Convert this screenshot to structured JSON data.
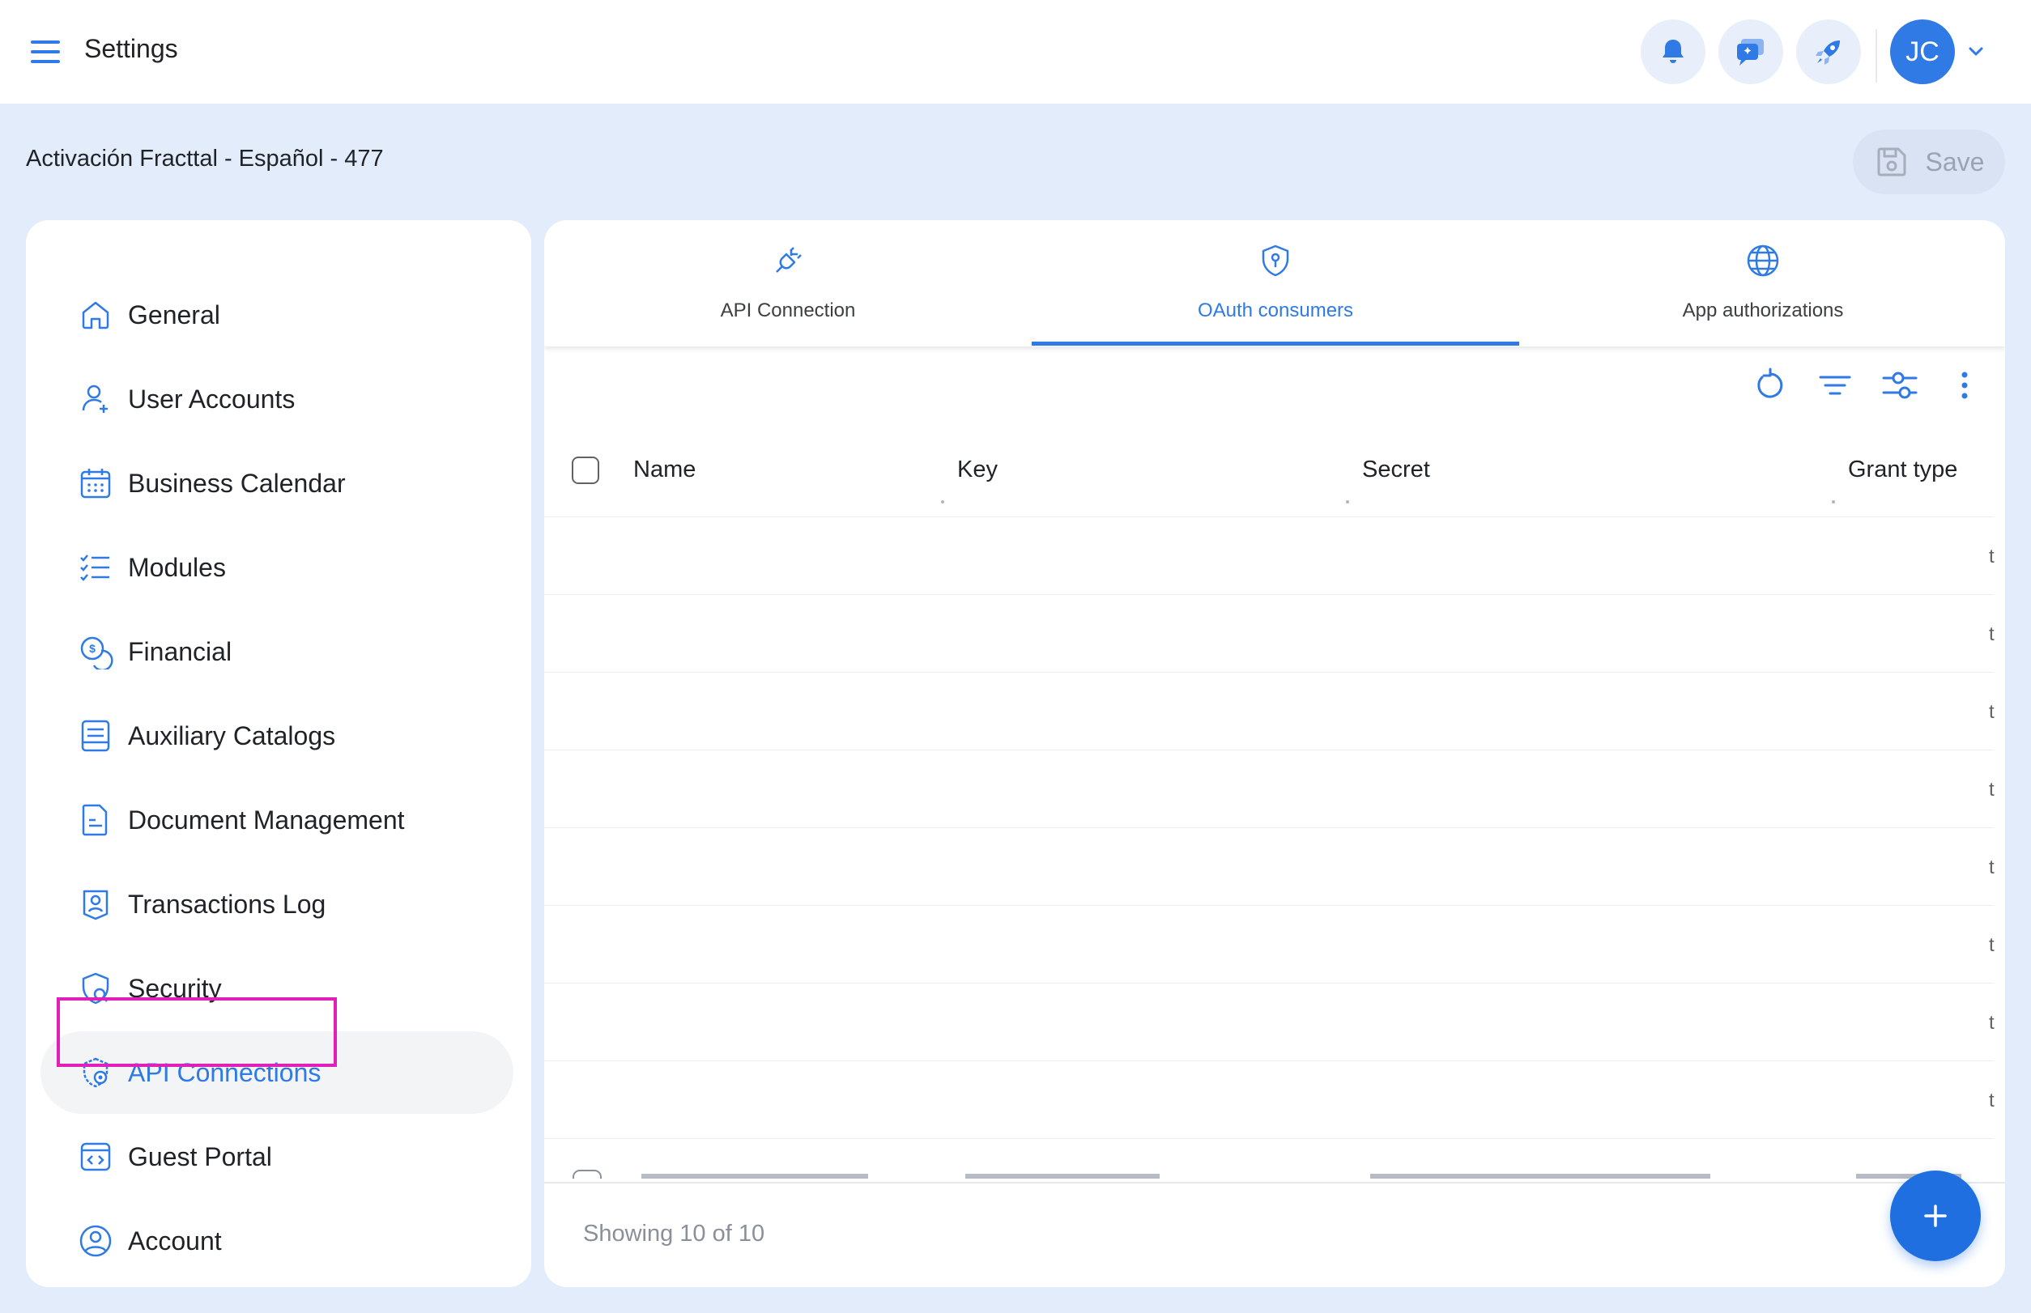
{
  "header": {
    "title": "Settings",
    "avatar_initials": "JC",
    "icons": [
      "menu-icon",
      "bell-icon",
      "chat-icon",
      "rocket-icon",
      "chevron-down-icon"
    ]
  },
  "subheader": {
    "org_name": "Activación Fracttal - Español - 477",
    "save_label": "Save"
  },
  "sidebar": {
    "items": [
      {
        "label": "General",
        "icon": "home-icon"
      },
      {
        "label": "User Accounts",
        "icon": "user-add-icon"
      },
      {
        "label": "Business Calendar",
        "icon": "calendar-icon"
      },
      {
        "label": "Modules",
        "icon": "checklist-icon"
      },
      {
        "label": "Financial",
        "icon": "coins-icon"
      },
      {
        "label": "Auxiliary Catalogs",
        "icon": "catalog-icon"
      },
      {
        "label": "Document Management",
        "icon": "document-icon"
      },
      {
        "label": "Transactions Log",
        "icon": "log-icon"
      },
      {
        "label": "Security",
        "icon": "shield-search-icon"
      },
      {
        "label": "API Connections",
        "icon": "api-gear-icon",
        "active": true
      },
      {
        "label": "Guest Portal",
        "icon": "code-window-icon"
      },
      {
        "label": "Account",
        "icon": "account-circle-icon"
      }
    ]
  },
  "tabs": [
    {
      "label": "API Connection",
      "icon": "plug-icon"
    },
    {
      "label": "OAuth consumers",
      "icon": "shield-key-icon",
      "active": true
    },
    {
      "label": "App authorizations",
      "icon": "globe-icon"
    }
  ],
  "toolbar": {
    "icons": [
      "refresh-icon",
      "filter-icon",
      "column-settings-icon",
      "more-vert-icon"
    ]
  },
  "table": {
    "columns": [
      "Name",
      "Key",
      "Secret",
      "Grant type"
    ],
    "row_fragments": [
      "t",
      "t",
      "t",
      "t",
      "t",
      "t",
      "t",
      "t"
    ]
  },
  "footer": {
    "showing": "Showing 10 of 10"
  },
  "colors": {
    "accent": "#2f7ae5",
    "background": "#e3ecfb",
    "highlight": "#e020b8"
  }
}
